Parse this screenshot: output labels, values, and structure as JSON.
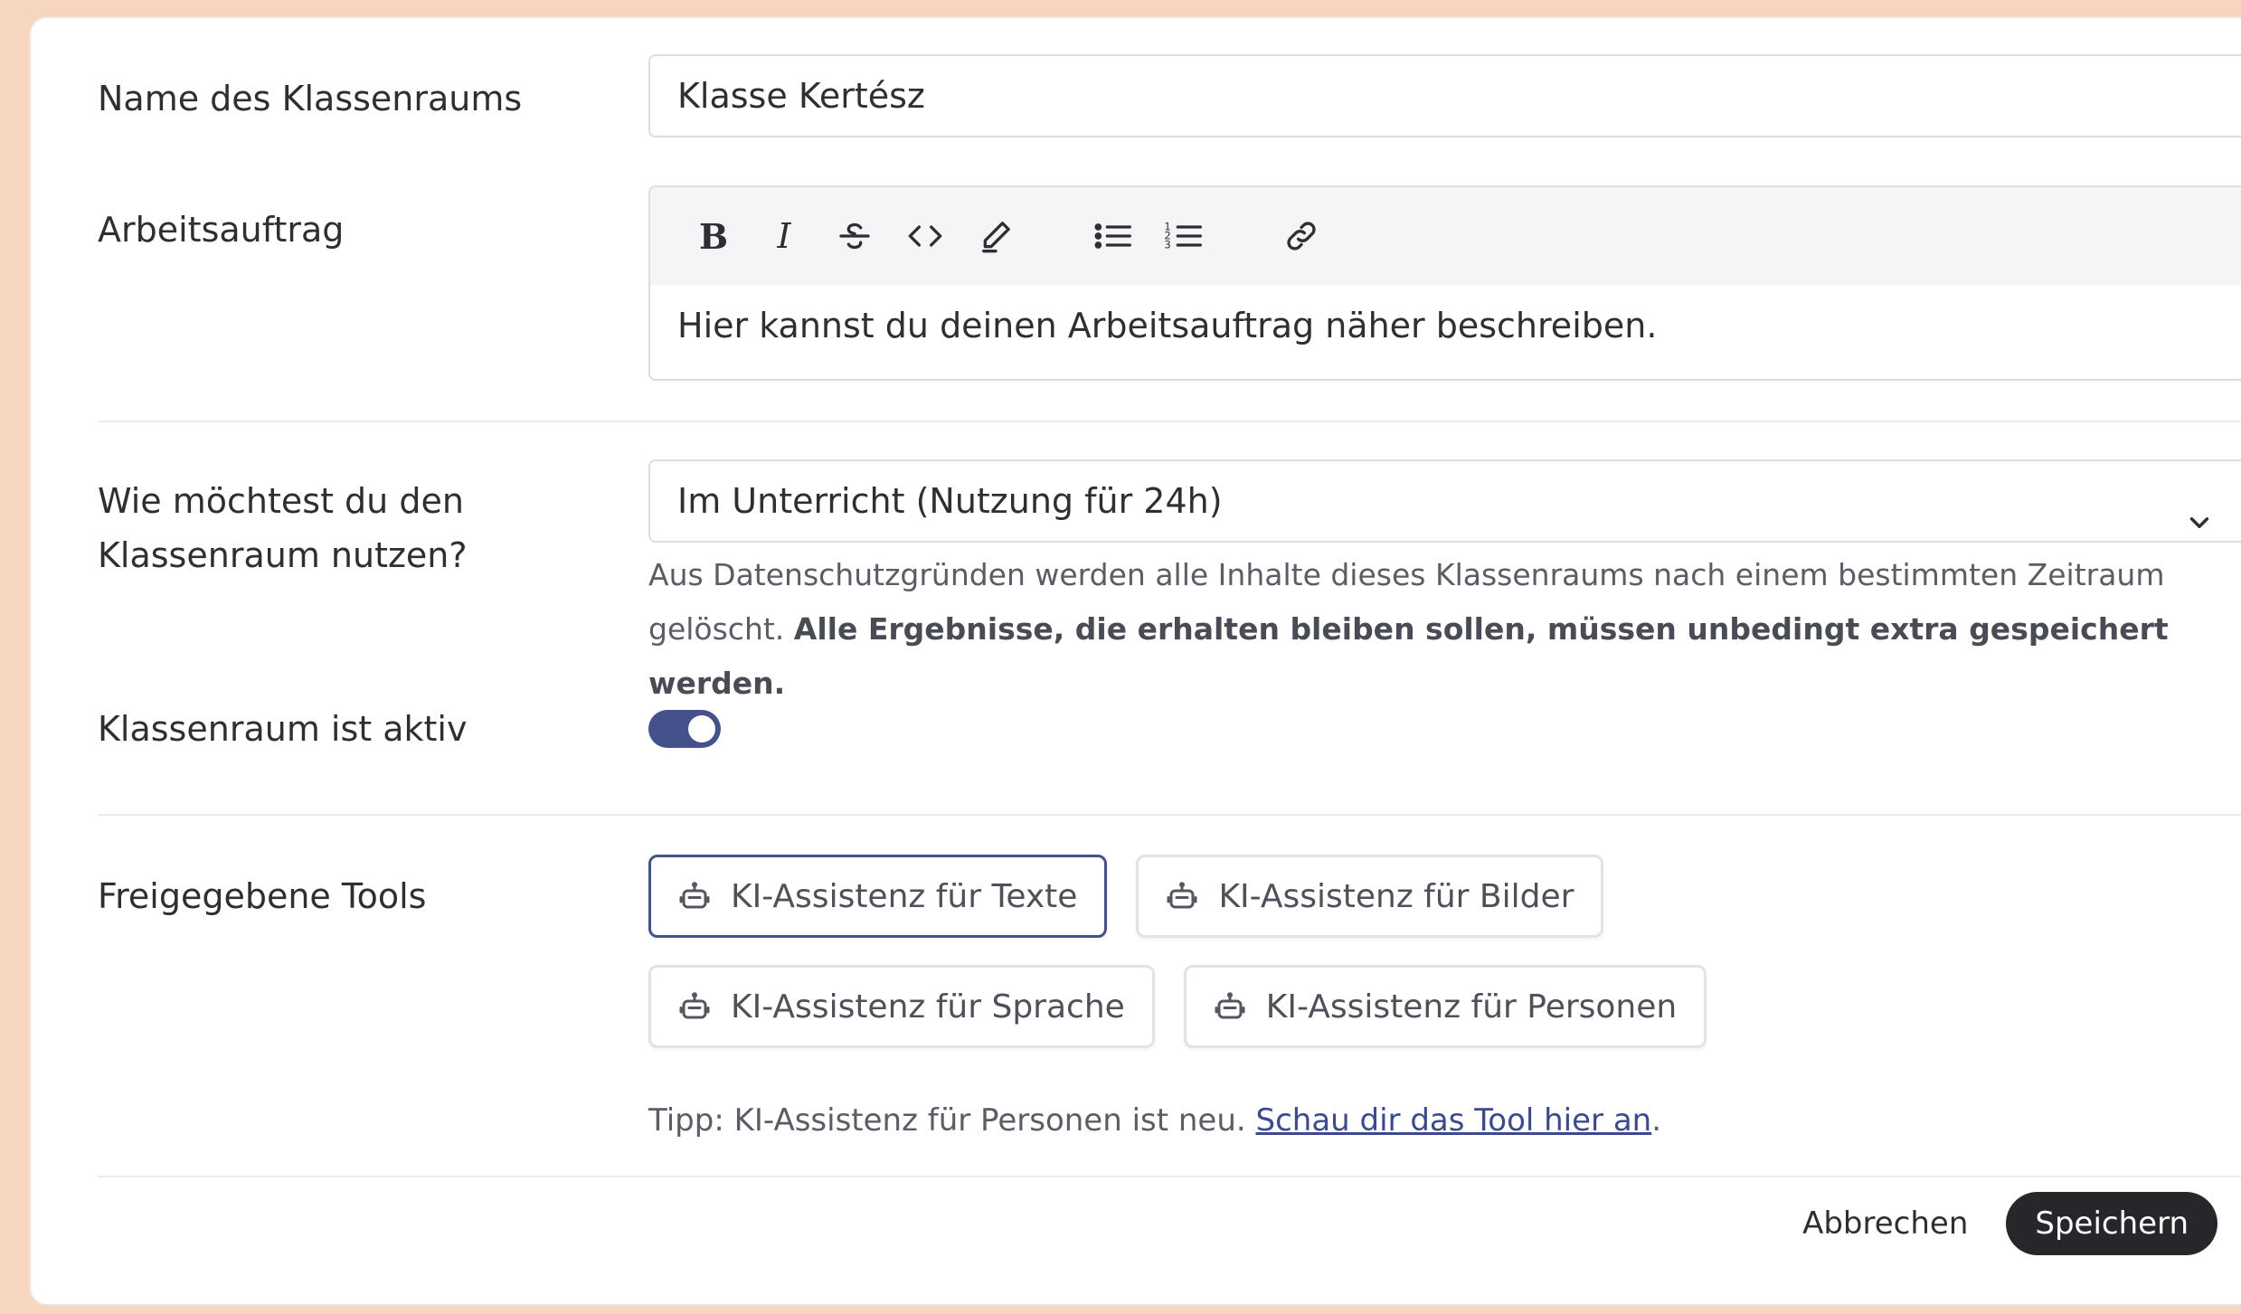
{
  "form": {
    "name": {
      "label": "Name des Klassenraums",
      "value": "Klasse Kertész"
    },
    "task": {
      "label": "Arbeitsauftrag",
      "toolbar": [
        "bold-icon",
        "italic-icon",
        "strikethrough-icon",
        "code-icon",
        "highlight-icon",
        "bullet-list-icon",
        "ordered-list-icon",
        "link-icon"
      ],
      "body_text": "Hier kannst du deinen Arbeitsauftrag näher beschreiben."
    },
    "usage": {
      "label_line1": "Wie möchtest du den",
      "label_line2": "Klassenraum nutzen?",
      "selected": "Im Unterricht (Nutzung für 24h)",
      "help_normal": "Aus Datenschutzgründen werden alle Inhalte dieses Klassenraums nach einem bestimmten Zeitraum gelöscht.",
      "help_bold": "Alle Ergebnisse, die erhalten bleiben sollen, müssen unbedingt extra gespeichert werden."
    },
    "active": {
      "label": "Klassenraum ist aktiv",
      "on": true
    },
    "tools": {
      "label": "Freigegebene Tools",
      "items": [
        {
          "label": "KI-Assistenz für Texte",
          "selected": true
        },
        {
          "label": "KI-Assistenz für Bilder",
          "selected": false
        },
        {
          "label": "KI-Assistenz für Sprache",
          "selected": false
        },
        {
          "label": "KI-Assistenz für Personen",
          "selected": false
        }
      ],
      "tip_prefix": "Tipp: KI-Assistenz für Personen ist neu.",
      "tip_link": "Schau dir das Tool hier an",
      "tip_suffix": "."
    }
  },
  "footer": {
    "cancel": "Abbrechen",
    "save": "Speichern"
  },
  "colors": {
    "accent": "#44518b",
    "background": "#f6d6bf",
    "primary_button": "#26272b"
  }
}
